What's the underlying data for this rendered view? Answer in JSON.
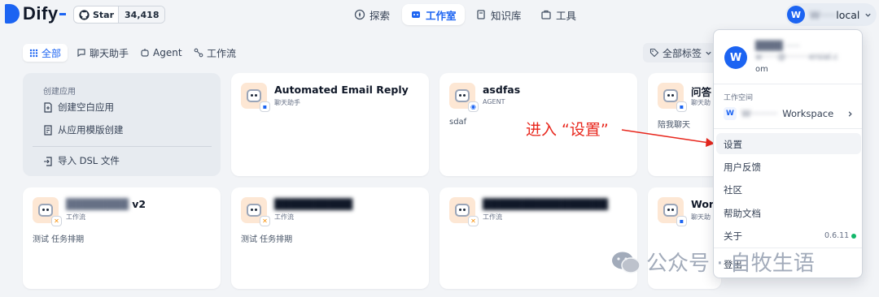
{
  "brand": {
    "name": "Dify"
  },
  "github": {
    "label": "Star",
    "count": "34,418"
  },
  "nav": [
    {
      "label": "探索",
      "icon": "compass-icon"
    },
    {
      "label": "工作室",
      "icon": "robot-icon"
    },
    {
      "label": "知识库",
      "icon": "book-icon"
    },
    {
      "label": "工具",
      "icon": "briefcase-icon"
    }
  ],
  "user": {
    "avatar_letter": "W",
    "name_visible": "local"
  },
  "tabs": [
    {
      "label": "全部",
      "icon": "grid-icon"
    },
    {
      "label": "聊天助手",
      "icon": "chat-icon"
    },
    {
      "label": "Agent",
      "icon": "agent-icon"
    },
    {
      "label": "工作流",
      "icon": "workflow-icon"
    }
  ],
  "tag_filter": {
    "label": "全部标签"
  },
  "create_panel": {
    "title": "创建应用",
    "blank": "创建空白应用",
    "template": "从应用模版创建",
    "import": "导入 DSL 文件"
  },
  "apps": [
    {
      "name": "Automated Email Reply",
      "type": "聊天助手",
      "desc": "",
      "badge": "chat"
    },
    {
      "name": "asdfas",
      "type": "AGENT",
      "desc": "sdaf",
      "badge": "agent"
    },
    {
      "name": "问答",
      "type": "聊天助",
      "desc": "陪我聊天",
      "badge": "chat"
    },
    {
      "name": "v2",
      "type": "工作流",
      "desc": "测试 任务排期",
      "badge": "workflow"
    },
    {
      "name": "",
      "type": "工作流",
      "desc": "测试 任务排期",
      "badge": "workflow"
    },
    {
      "name": "",
      "type": "工作流",
      "desc": "",
      "badge": "workflow"
    },
    {
      "name": "Worl",
      "type": "聊天助",
      "desc": "",
      "badge": "chat"
    }
  ],
  "annotation": "进入 “设置”",
  "menu": {
    "email_suffix": "om",
    "workspace_title": "工作空间",
    "workspace_letter": "W",
    "workspace_name": "Workspace",
    "items": [
      "设置",
      "用户反馈",
      "社区",
      "帮助文档",
      "关于",
      "登出"
    ],
    "version": "0.6.11",
    "version_color": "#12b76a"
  },
  "watermark": {
    "text": "公众号 · 自牧生语"
  },
  "colors": {
    "accent": "#1c64f2",
    "annotation": "#e8271d"
  }
}
